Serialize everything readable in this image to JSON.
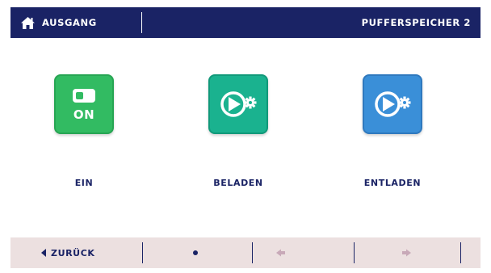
{
  "header": {
    "home_label": "AUSGANG",
    "title": "PUFFERSPEICHER 2",
    "home_icon": "home-icon"
  },
  "tiles": [
    {
      "label": "EIN",
      "badge": "ON",
      "icon": "toggle-switch-icon",
      "color": "#32bb62"
    },
    {
      "label": "BELADEN",
      "icon": "pump-gear-icon",
      "color": "#1ab28f"
    },
    {
      "label": "ENTLADEN",
      "icon": "pump-gear-icon",
      "color": "#3a8fd8"
    }
  ],
  "footer": {
    "back_label": "ZURÜCK",
    "back_icon": "caret-left-icon",
    "prev_icon": "arrow-left-icon",
    "next_icon": "arrow-right-icon"
  },
  "colors": {
    "navy": "#1a2365",
    "footer_bg": "#ece0e0",
    "arrow_disabled": "#c8a9b8"
  }
}
